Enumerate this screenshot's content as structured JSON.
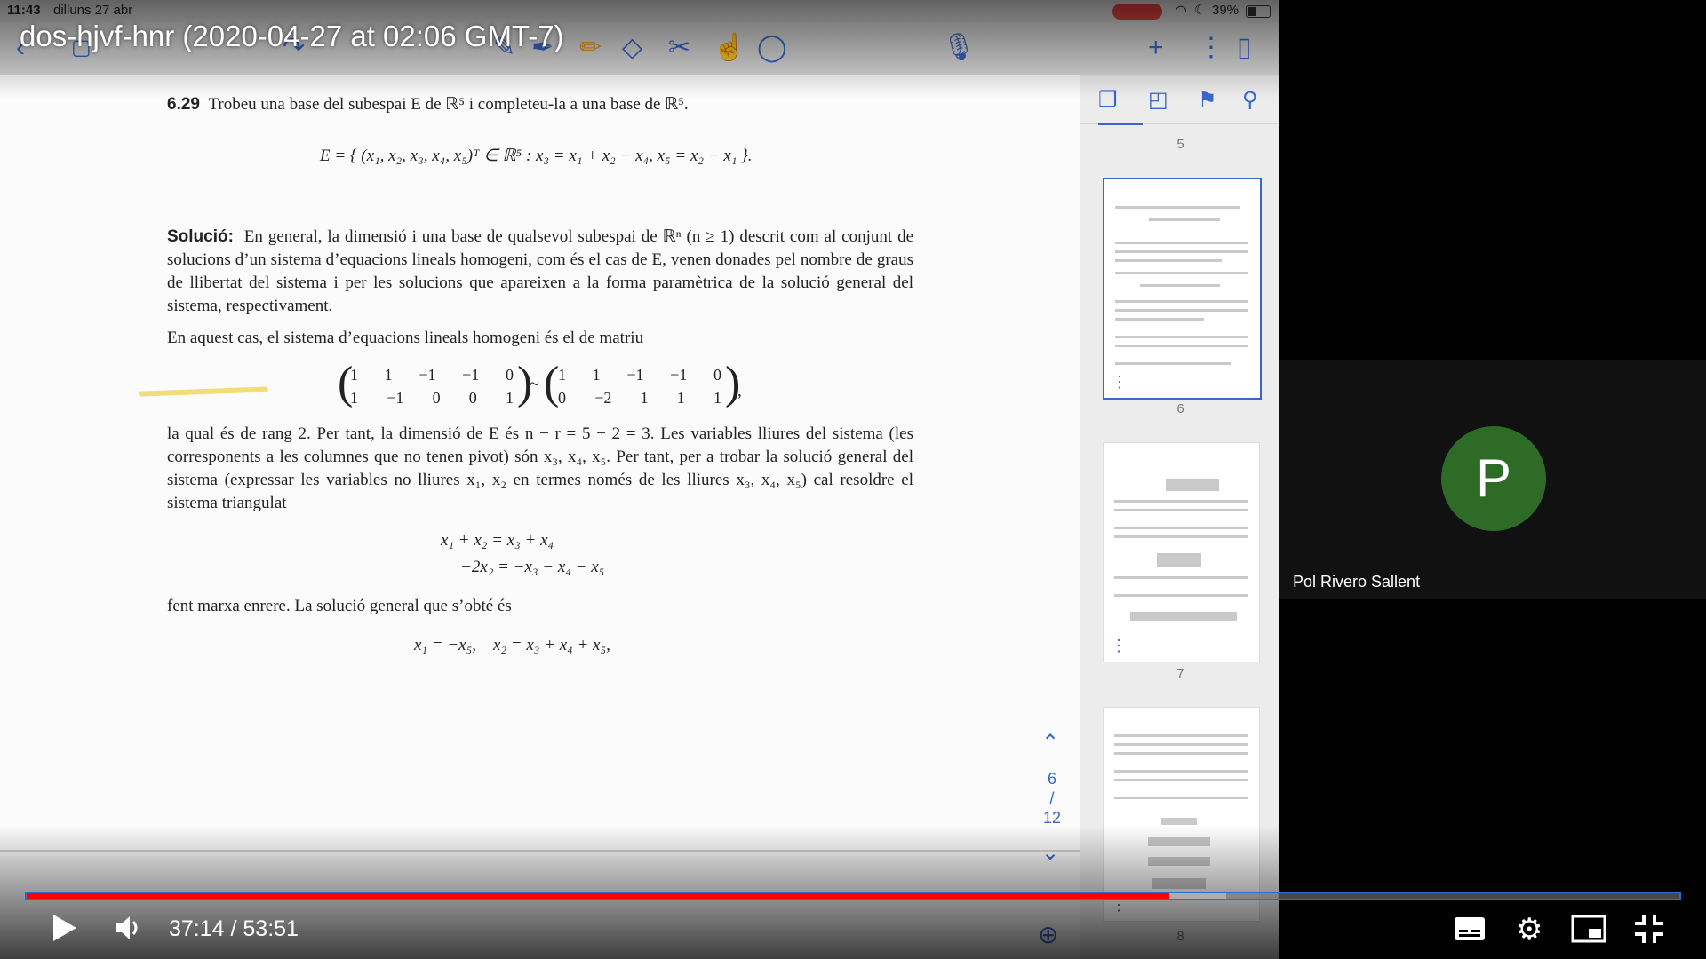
{
  "video": {
    "title": "dos-hjvf-hnr (2020-04-27 at 02:06 GMT-7)",
    "time_current": "37:14",
    "time_total": "53:51",
    "time_label": "37:14 / 53:51",
    "progress_played": 0.6915,
    "progress_buffered": 0.7259
  },
  "ipad_status": {
    "time": "11:43",
    "date": "dilluns 27 abr",
    "battery": "39%"
  },
  "toolbar_icons": [
    "back-icon",
    "pen-icon",
    "highlighter-icon",
    "eraser-icon",
    "scissors-icon",
    "hand-icon",
    "lasso-icon",
    "microphone-icon",
    "plus-icon",
    "more-icon",
    "sidebar-icon"
  ],
  "document": {
    "problem_number": "6.29",
    "problem_text": "Trobeu una base del subespai E de ℝ⁵ i completeu-la a una base de ℝ⁵.",
    "set_definition": "E = { (x₁, x₂, x₃, x₄, x₅)ᵀ ∈ ℝ⁵ : x₃ = x₁ + x₂ − x₄,  x₅ = x₂ − x₁ }.",
    "solution_label": "Solució:",
    "solution_text": "En general, la dimensió i una base de qualsevol subespai de ℝⁿ (n ≥ 1) descrit com al conjunt de solucions d’un sistema d’equacions lineals homogeni, com és el cas de E, venen donades pel nombre de graus de llibertat del sistema i per les solucions que apareixen a la forma paramètrica de la solució general del sistema, respectivament.",
    "matrix_intro": "En aquest cas, el sistema d’equacions lineals homogeni és el de matriu",
    "matrix_left": [
      [
        "1",
        "1",
        "−1",
        "−1",
        "0"
      ],
      [
        "1",
        "−1",
        "0",
        "0",
        "1"
      ]
    ],
    "matrix_right": [
      [
        "1",
        "1",
        "−1",
        "−1",
        "0"
      ],
      [
        "0",
        "−2",
        "1",
        "1",
        "1"
      ]
    ],
    "rank_text": "la qual és de rang 2. Per tant, la dimensió de E és n − r = 5 − 2 = 3. Les variables lliures del sistema (les corresponents a les columnes que no tenen pivot) són x₃, x₄, x₅. Per tant, per a trobar la solució general del sistema (expressar les variables no lliures x₁, x₂ en termes només de les lliures x₃, x₄, x₅) cal resoldre el sistema triangulat",
    "system_eq1": "x₁ + x₂ = x₃ + x₄",
    "system_eq2": "−2x₂ = −x₃ − x₄ − x₅",
    "backsub_text": "fent marxa enrere. La solució general que s’obté és",
    "general_solution": "x₁ = −x₅,    x₂ = x₃ + x₄ + x₅,"
  },
  "pager": {
    "current": "6",
    "separator": "/",
    "total": "12"
  },
  "thumbnails": {
    "page_top": "5",
    "page_a": "6",
    "page_b": "7",
    "page_c": "8"
  },
  "participant": {
    "initial": "P",
    "name": "Pol Rivero Sallent",
    "avatar_color": "#2e6b27"
  }
}
